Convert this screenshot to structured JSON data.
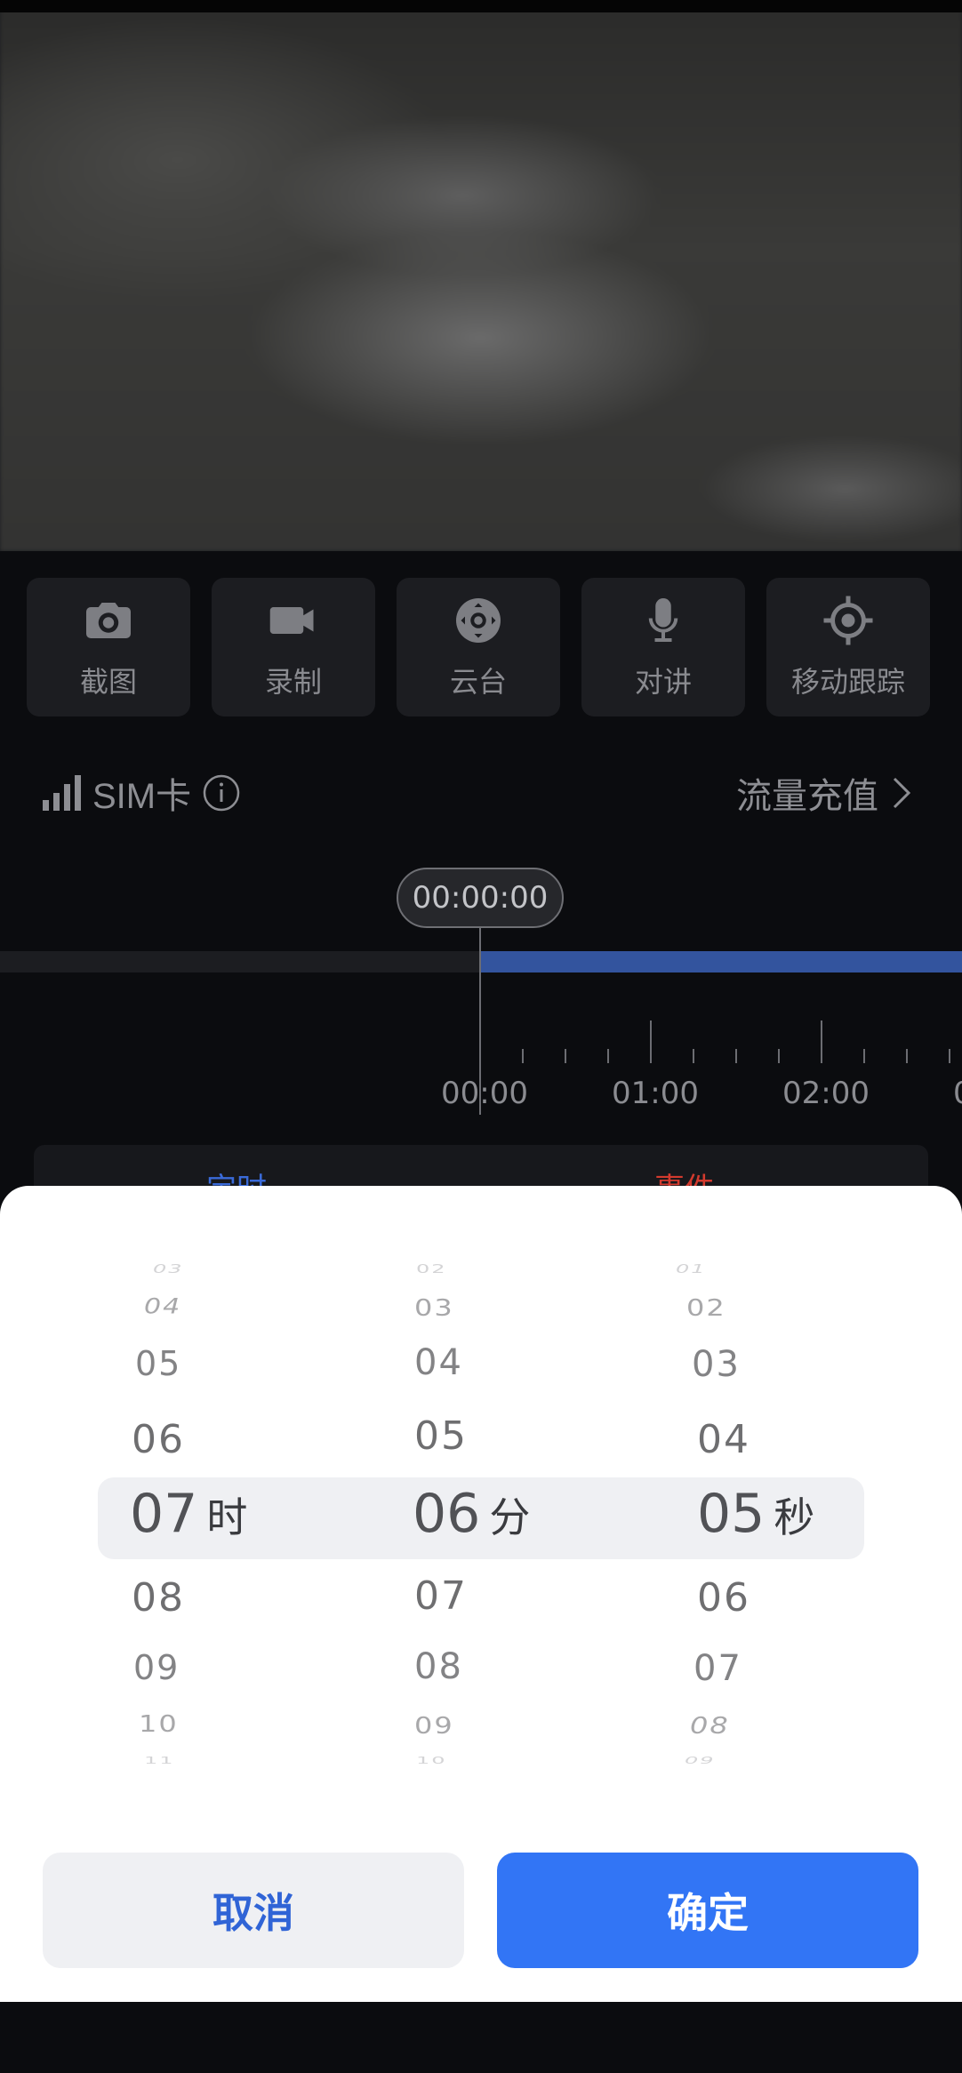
{
  "toolbar": {
    "items": [
      {
        "label": "截图",
        "icon": "camera-icon"
      },
      {
        "label": "录制",
        "icon": "video-camera-icon"
      },
      {
        "label": "云台",
        "icon": "ptz-joystick-icon"
      },
      {
        "label": "对讲",
        "icon": "microphone-icon"
      },
      {
        "label": "移动跟踪",
        "icon": "target-icon"
      }
    ]
  },
  "status": {
    "sim_label": "SIM卡",
    "recharge_label": "流量充值"
  },
  "timeline": {
    "current_time": "00:00:00",
    "ticks": [
      "00:00",
      "01:00",
      "02:00",
      "0"
    ],
    "modes": [
      "定时",
      "事件"
    ]
  },
  "picker": {
    "hours": {
      "above": [
        "03",
        "04",
        "05",
        "06"
      ],
      "selected": "07",
      "unit": "时",
      "below": [
        "08",
        "09",
        "10",
        "11"
      ]
    },
    "minutes": {
      "above": [
        "02",
        "03",
        "04",
        "05"
      ],
      "selected": "06",
      "unit": "分",
      "below": [
        "07",
        "08",
        "09",
        "10"
      ]
    },
    "seconds": {
      "above": [
        "01",
        "02",
        "03",
        "04"
      ],
      "selected": "05",
      "unit": "秒",
      "below": [
        "06",
        "07",
        "08",
        "09"
      ]
    }
  },
  "actions": {
    "cancel_label": "取消",
    "confirm_label": "确定"
  },
  "colors": {
    "accent": "#3275f5",
    "timeline_recorded": "#33549e",
    "event_red": "#d33a2e",
    "timed_blue": "#3a6ad8"
  }
}
